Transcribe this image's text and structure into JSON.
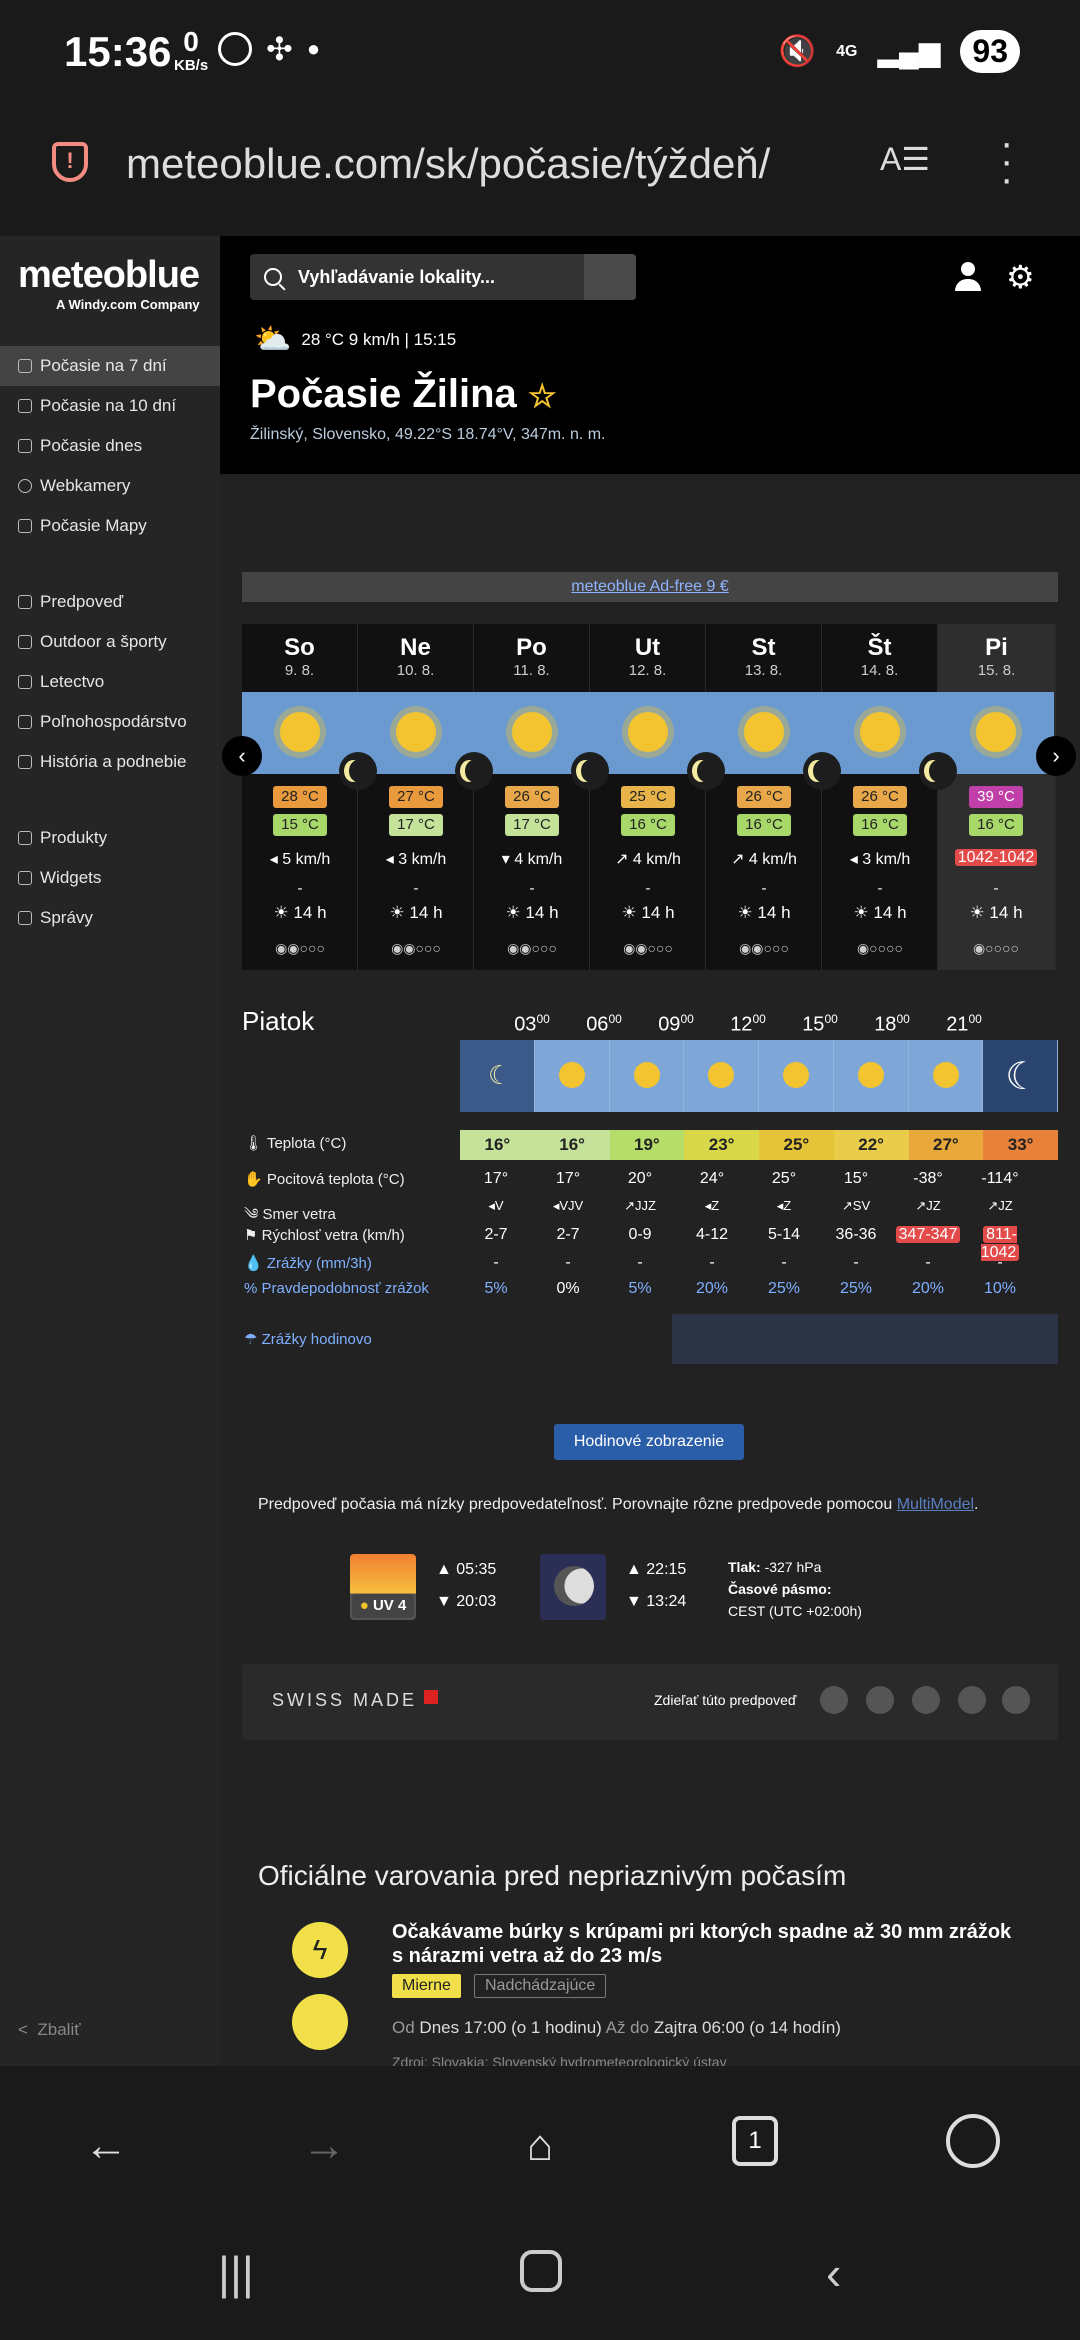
{
  "status": {
    "time": "15:36",
    "kbs_value": "0",
    "kbs_unit": "KB/s",
    "net": "4G",
    "battery": "93"
  },
  "browser": {
    "url": "meteoblue.com/sk/počasie/týždeň/"
  },
  "sidebar": {
    "brand": "meteoblue",
    "tagline": "A Windy.com Company",
    "items": [
      {
        "label": "Počasie na 7 dní"
      },
      {
        "label": "Počasie na 10 dní"
      },
      {
        "label": "Počasie dnes"
      },
      {
        "label": "Webkamery"
      },
      {
        "label": "Počasie Mapy"
      },
      {
        "label": "Predpoveď"
      },
      {
        "label": "Outdoor a športy"
      },
      {
        "label": "Letectvo"
      },
      {
        "label": "Poľnohospodárstvo"
      },
      {
        "label": "História a podnebie"
      },
      {
        "label": "Produkty"
      },
      {
        "label": "Widgets"
      },
      {
        "label": "Správy"
      }
    ],
    "collapse": "Zbaliť"
  },
  "header": {
    "search_placeholder": "Vyhľadávanie lokality...",
    "current": "28 °C  9 km/h | 15:15",
    "title": "Počasie Žilina",
    "subtitle": "Žilinský, Slovensko, 49.22°S 18.74°V, 347m. n. m."
  },
  "ad": "meteoblue Ad-free 9 €",
  "days": [
    {
      "name": "So",
      "date": "9. 8.",
      "tmax": "28 °C",
      "tmin": "15 °C",
      "wind": "◂ 5 km/h",
      "dash": "-",
      "sun": "☀ 14 h",
      "pred": "◉◉○○○"
    },
    {
      "name": "Ne",
      "date": "10. 8.",
      "tmax": "27 °C",
      "tmin": "17 °C",
      "wind": "◂ 3 km/h",
      "dash": "-",
      "sun": "☀ 14 h",
      "pred": "◉◉○○○"
    },
    {
      "name": "Po",
      "date": "11. 8.",
      "tmax": "26 °C",
      "tmin": "17 °C",
      "wind": "▾ 4 km/h",
      "dash": "-",
      "sun": "☀ 14 h",
      "pred": "◉◉○○○"
    },
    {
      "name": "Ut",
      "date": "12. 8.",
      "tmax": "25 °C",
      "tmin": "16 °C",
      "wind": "↗ 4 km/h",
      "dash": "-",
      "sun": "☀ 14 h",
      "pred": "◉◉○○○"
    },
    {
      "name": "St",
      "date": "13. 8.",
      "tmax": "26 °C",
      "tmin": "16 °C",
      "wind": "↗ 4 km/h",
      "dash": "-",
      "sun": "☀ 14 h",
      "pred": "◉◉○○○"
    },
    {
      "name": "Št",
      "date": "14. 8.",
      "tmax": "26 °C",
      "tmin": "16 °C",
      "wind": "◂ 3 km/h",
      "dash": "-",
      "sun": "☀ 14 h",
      "pred": "◉○○○○"
    },
    {
      "name": "Pi",
      "date": "15. 8.",
      "tmax": "39 °C",
      "tmin": "16 °C",
      "wind": "1042-1042",
      "dash": "-",
      "sun": "☀ 14 h",
      "pred": "◉○○○○"
    }
  ],
  "detail": {
    "day": "Piatok",
    "hours": [
      "03",
      "06",
      "09",
      "12",
      "15",
      "18",
      "21"
    ],
    "hours_sup": "00",
    "labels": {
      "temp": "Teplota (°C)",
      "feels": "Pocitová teplota (°C)",
      "dir": "Smer vetra",
      "speed": "Rýchlosť vetra (km/h)",
      "precip": "Zrážky (mm/3h)",
      "prob": "Pravdepodobnosť zrážok",
      "hourly": "Zrážky hodinovo"
    },
    "temp": [
      "16°",
      "16°",
      "19°",
      "23°",
      "25°",
      "22°",
      "27°",
      "33°"
    ],
    "feels": [
      "17°",
      "17°",
      "20°",
      "24°",
      "25°",
      "15°",
      "-38°",
      "-114°"
    ],
    "dir": [
      "◂V",
      "◂VJV",
      "↗JJZ",
      "◂Z",
      "◂Z",
      "↗SV",
      "↗JZ",
      "↗JZ"
    ],
    "speed": [
      "2-7",
      "2-7",
      "0-9",
      "4-12",
      "5-14",
      "36-36",
      "347-347",
      "811-1042"
    ],
    "precip": [
      "-",
      "-",
      "-",
      "-",
      "-",
      "-",
      "-",
      "-"
    ],
    "prob": [
      "5%",
      "0%",
      "5%",
      "20%",
      "25%",
      "25%",
      "20%",
      "10%"
    ]
  },
  "hourly_button": "Hodinové zobrazenie",
  "note": "Predpoveď počasia má nízky predpovedateľnosť. Porovnajte rôzne predpovede pomocou",
  "note_link": "MultiModel",
  "note_end": ".",
  "astro": {
    "uv": "UV 4",
    "sunrise": "▲ 05:35",
    "sunset": "▼ 20:03",
    "moonrise": "▲ 22:15",
    "moonset": "▼ 13:24",
    "pressure_label": "Tlak:",
    "pressure": " -327 hPa",
    "tz_label": "Časové pásmo:",
    "tz": "CEST (UTC +02:00h)"
  },
  "swiss": {
    "label": "SWISS MADE",
    "share": "Zdieľať túto predpoveď"
  },
  "warnings": {
    "title": "Oficiálne varovania pred nepriaznivým počasím",
    "text": "Očakávame búrky s krúpami pri ktorých spadne až 30 mm zrážok s nárazmi vetra až do 23 m/s",
    "tag1": "Mierne",
    "tag2": "Nadchádzajúce",
    "from_label": "Od",
    "from": "Dnes 17:00 (o 1 hodinu)",
    "to_label": "Až do",
    "to": "Zajtra 06:00 (o 14 hodín)",
    "source": "Zdroj: Slovakia: Slovenský hydrometeorologický ústav"
  }
}
